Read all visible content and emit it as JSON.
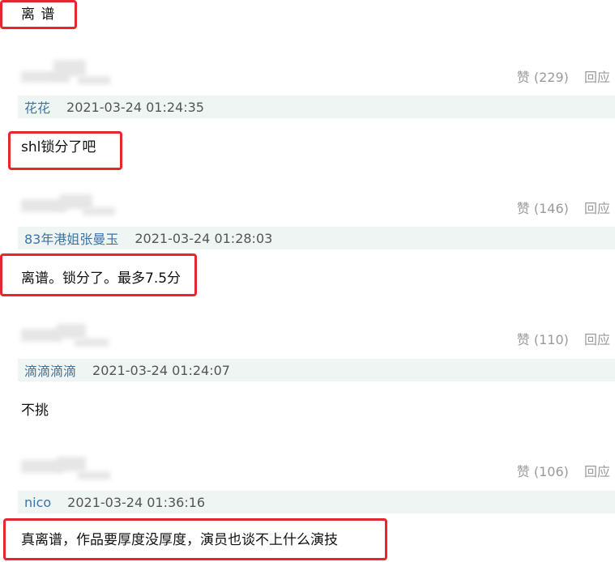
{
  "page": {
    "top_text": "离 谱"
  },
  "comments": [
    {
      "likes_label": "赞",
      "likes_count": "(229)",
      "reply_label": "回应",
      "username": "花花",
      "timestamp": "2021-03-24 01:24:35",
      "text": "shl锁分了吧"
    },
    {
      "likes_label": "赞",
      "likes_count": "(146)",
      "reply_label": "回应",
      "username": "83年港姐张曼玉",
      "timestamp": "2021-03-24 01:28:03",
      "text": "离谱。锁分了。最多7.5分"
    },
    {
      "likes_label": "赞",
      "likes_count": "(110)",
      "reply_label": "回应",
      "username": "滴滴滴滴",
      "timestamp": "2021-03-24 01:24:07",
      "text": "不挑"
    },
    {
      "likes_label": "赞",
      "likes_count": "(106)",
      "reply_label": "回应",
      "username": "nico",
      "timestamp": "2021-03-24 01:36:16",
      "text": "真离谱，作品要厚度没厚度，演员也谈不上什么演技"
    }
  ],
  "colors": {
    "highlight_border": "#e8262d",
    "username": "#3a74a8",
    "user_bar_bg": "#eff5f3",
    "meta_gray": "#9a9a9a"
  }
}
